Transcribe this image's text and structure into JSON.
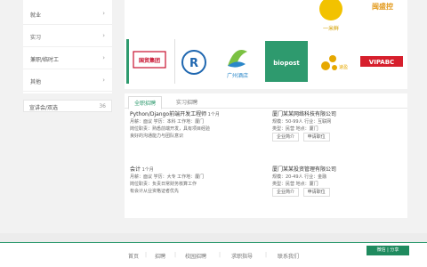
{
  "sidebar": {
    "items": [
      {
        "label": "就业"
      },
      {
        "label": "实习"
      },
      {
        "label": "兼职/临时工"
      },
      {
        "label": "其他"
      }
    ],
    "more": {
      "label": "宣讲会/双选",
      "count": "36"
    }
  },
  "logos": [
    {
      "name": "一米鲜",
      "color": "#e8b300"
    },
    {
      "name": "闽盛控",
      "color": "#e39b1f"
    },
    {
      "name": "国贸集团",
      "color": "#c8102e"
    },
    {
      "name": "R",
      "color": "#1f67b0"
    },
    {
      "name": "广州酒店",
      "color": "#2b87c9"
    },
    {
      "name": "biopost",
      "color": "#2e9a6e"
    },
    {
      "name": "速盈",
      "color": "#e6a800"
    },
    {
      "name": "VIPABC",
      "color": "#d61f2c"
    }
  ],
  "tabs": [
    {
      "label": "全职招聘"
    },
    {
      "label": "实习招聘"
    }
  ],
  "jobs": [
    {
      "title": "Python/Django前端开发工程师",
      "tag": "1个月",
      "meta": "月薪：面议 学历：本科 工作地：厦门",
      "desc1": "岗位职责：熟悉前端开发，具有项目经验",
      "desc2": "良好的沟通能力与团队意识",
      "company": "厦门某某网络科技有限公司",
      "company_meta": "规模：50-99人 行业：互联网",
      "company_meta2": "类型：民营 地点：厦门",
      "btn1": "企业简介",
      "btn2": "申请职位"
    },
    {
      "title": "会计",
      "tag": "1个月",
      "meta": "月薪：面议 学历：大专 工作地：厦门",
      "desc1": "岗位职责：负责日常财务核算工作",
      "desc2": "有会计从业资格证者优先",
      "company": "厦门某某投资管理有限公司",
      "company_meta": "规模：20-49人 行业：金融",
      "company_meta2": "类型：民营 地点：厦门",
      "btn1": "企业简介",
      "btn2": "申请职位"
    }
  ],
  "footer": {
    "links": [
      "首页",
      "招聘",
      "校园招聘",
      "求职指导",
      "联系我们"
    ],
    "badge": "微信 | 分享"
  }
}
